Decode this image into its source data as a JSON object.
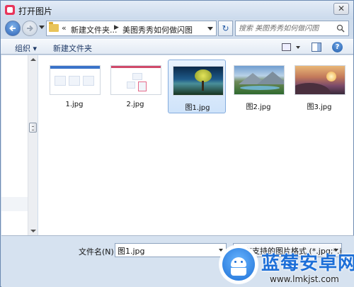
{
  "window": {
    "title": "打开图片"
  },
  "address": {
    "prefix": "«",
    "crumbs": [
      "新建文件夹...",
      "美图秀秀如何做闪图"
    ],
    "search_placeholder": "搜索 美图秀秀如何做闪图"
  },
  "toolbar": {
    "organize_label": "组织 ▾",
    "new_folder_label": "新建文件夹"
  },
  "files": [
    {
      "name": "1.jpg",
      "kind": "screenshot",
      "selected": false
    },
    {
      "name": "2.jpg",
      "kind": "screenshot",
      "selected": false
    },
    {
      "name": "图1.jpg",
      "kind": "landscape-tree",
      "selected": true
    },
    {
      "name": "图2.jpg",
      "kind": "landscape-lake",
      "selected": false
    },
    {
      "name": "图3.jpg",
      "kind": "landscape-sunset",
      "selected": false
    }
  ],
  "bottom": {
    "filename_label": "文件名(N):",
    "filename_value": "图1.jpg",
    "filetype_value": "所有支持的图片格式 (*.jpg;*.jp"
  },
  "watermark": {
    "title": "蓝莓安卓网",
    "url": "www.lmkjst.com"
  },
  "colors": {
    "selection": "#cfe3fa",
    "accent": "#1d6fd8",
    "titlebar": "#cbdaec"
  }
}
